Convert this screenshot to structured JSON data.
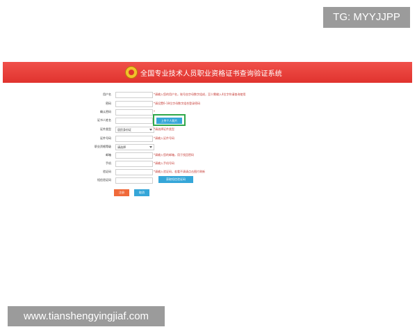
{
  "watermarks": {
    "top": "TG: MYYJJPP",
    "bottom": "www.tianshengyingjiaf.com"
  },
  "header": {
    "title": "全国专业技术人员职业资格证书查询验证系统"
  },
  "form": {
    "rows": [
      {
        "label": "用户名",
        "hint": "*请输入您的用户名，账号由字母数字组成，至少需输入4位字符请查询使用"
      },
      {
        "label": "密码",
        "hint": "*请设置6-18位字母数字组合登录密码"
      },
      {
        "label": "确认密码",
        "hint": "*"
      },
      {
        "label": "证书人姓名",
        "hint": ""
      },
      {
        "label": "证件类型",
        "select": "居民身份证",
        "hint": "*请选择证件类型"
      },
      {
        "label": "证件号码",
        "hint": "*请输入证件号码"
      },
      {
        "label": "职业资格等级",
        "select": "请选择",
        "hint": ""
      },
      {
        "label": "邮箱",
        "hint": "*请输入您的邮箱，用于找回密码"
      },
      {
        "label": "手机",
        "hint": "*请输入手机号码"
      },
      {
        "label": "验证码",
        "hint": "*请输入验证码，若看不清请点击图片刷新"
      },
      {
        "label": "短信验证码",
        "hint": ""
      }
    ],
    "upload_button": "上传个人照片",
    "verify_button": "获取短信验证码",
    "submit_button": "注册",
    "reset_button": "取消"
  },
  "colors": {
    "banner": "#e0332e",
    "hint": "#c53a34",
    "primary_button": "#35a6d8",
    "submit_button": "#f06a3a",
    "highlight_frame": "#2fa84a"
  }
}
